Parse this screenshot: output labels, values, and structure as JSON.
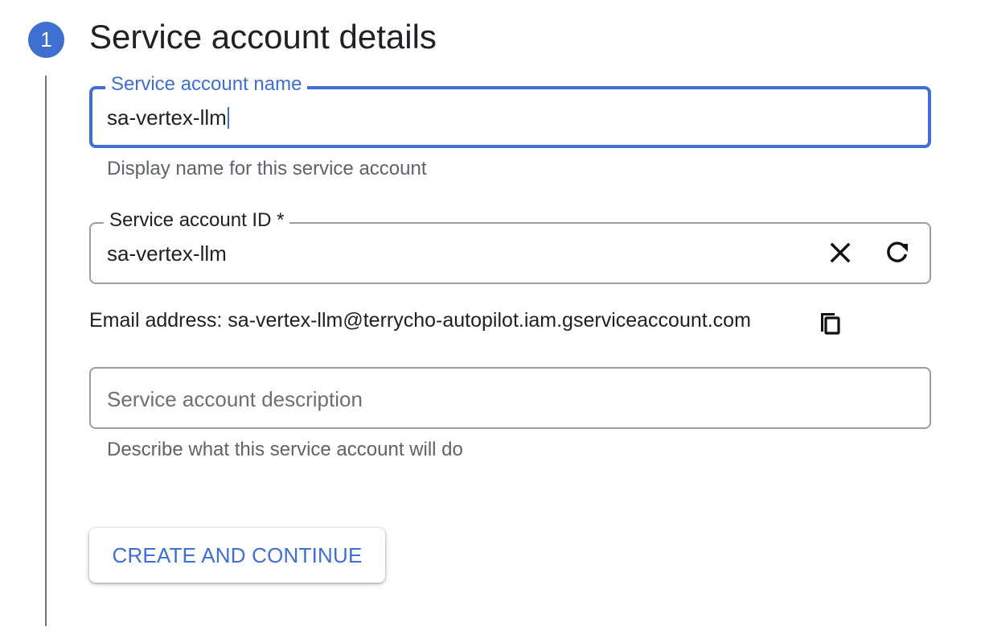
{
  "step": {
    "number": "1",
    "title": "Service account details"
  },
  "fields": {
    "name": {
      "label": "Service account name",
      "value": "sa-vertex-llm",
      "helper": "Display name for this service account",
      "focused": true
    },
    "id": {
      "label": "Service account ID *",
      "value": "sa-vertex-llm",
      "icons": [
        "close-icon",
        "refresh-icon"
      ]
    },
    "email": {
      "text": "Email address: sa-vertex-llm@terrycho-autopilot.iam.gserviceaccount.com",
      "icon": "copy-icon"
    },
    "description": {
      "placeholder": "Service account description",
      "helper": "Describe what this service account will do"
    }
  },
  "actions": {
    "create_label": "CREATE AND CONTINUE"
  },
  "colors": {
    "accent": "#3f6fd1",
    "text": "#202124",
    "muted": "#5f6368",
    "border": "#9e9e9e"
  }
}
